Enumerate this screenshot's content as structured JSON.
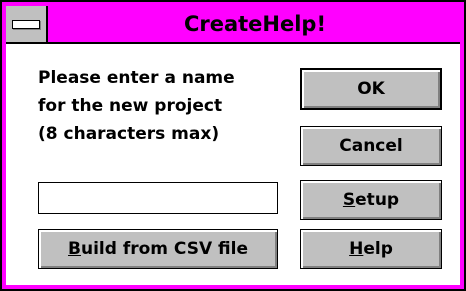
{
  "window": {
    "title": "CreateHelp!",
    "title_color": "#ff00ff",
    "system_menu_icon": "system-menu-dash"
  },
  "prompt": {
    "line1": "Please enter a name",
    "line2": "for the new project",
    "line3": "(8 characters max)"
  },
  "name_input": {
    "value": ""
  },
  "buttons": {
    "ok": "OK",
    "cancel": "Cancel",
    "setup": {
      "mnemonic": "S",
      "rest": "etup"
    },
    "help": {
      "mnemonic": "H",
      "rest": "elp"
    },
    "build_csv": {
      "mnemonic": "B",
      "rest": "uild from CSV file"
    }
  }
}
